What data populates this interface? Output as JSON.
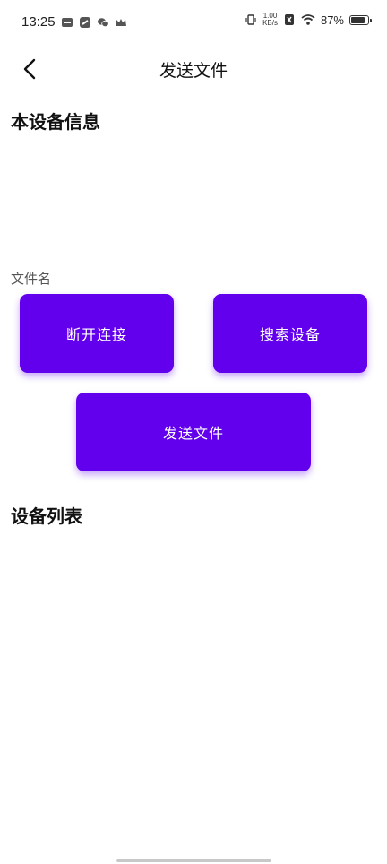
{
  "status_bar": {
    "time": "13:25",
    "net_speed_value": "1.00",
    "net_speed_unit": "KB/s",
    "battery_percent": "87%",
    "battery_level": 0.87,
    "icons": [
      "app-notification-icon",
      "sync-icon",
      "wechat-icon",
      "crown-icon",
      "vibrate-icon",
      "sim-off-icon",
      "wifi-icon",
      "battery-icon"
    ]
  },
  "app_bar": {
    "title": "发送文件"
  },
  "device_info": {
    "heading": "本设备信息"
  },
  "file": {
    "label": "文件名"
  },
  "buttons": {
    "disconnect": "断开连接",
    "search": "搜索设备",
    "send": "发送文件"
  },
  "device_list": {
    "heading": "设备列表"
  },
  "colors": {
    "accent": "#6200EE"
  }
}
